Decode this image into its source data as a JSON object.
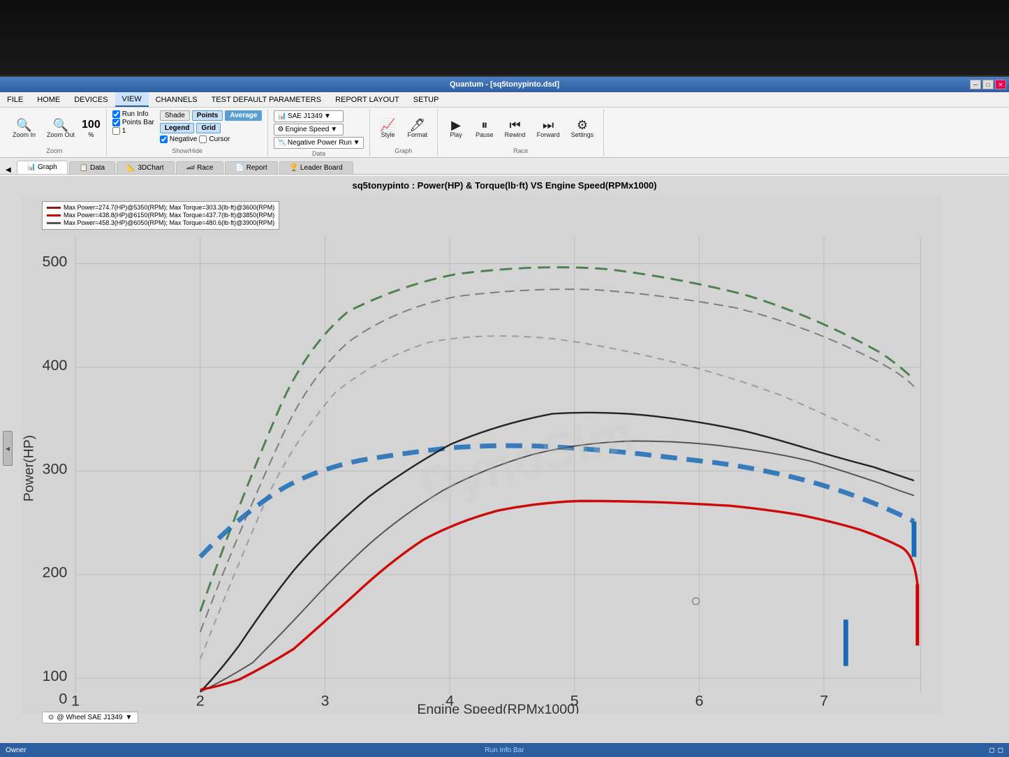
{
  "window": {
    "title": "Quantum - [sq5tonypinto.dsd]",
    "title_bar_color": "#3a6cb5"
  },
  "menu": {
    "items": [
      "FILE",
      "HOME",
      "DEVICES",
      "VIEW",
      "CHANNELS",
      "TEST DEFAULT PARAMETERS",
      "REPORT LAYOUT",
      "SETUP"
    ],
    "active": "VIEW"
  },
  "ribbon": {
    "zoom_group": {
      "label": "Zoom",
      "zoom_in": "Zoom In",
      "zoom_out": "Zoom Out",
      "percent": "100",
      "pct_label": "%"
    },
    "showhide_group": {
      "label": "Show/Hide",
      "run_info": "Run Info",
      "points_bar": "Points Bar",
      "item1": "1",
      "shade": "Shade",
      "points": "Points",
      "average": "Average",
      "legend": "Legend",
      "grid": "Grid",
      "negative": "Negative",
      "cursor": "Cursor"
    },
    "data_group": {
      "label": "Data",
      "sae": "SAE J1349",
      "engine_speed": "Engine Speed",
      "neg_power_run": "Negative Power Run"
    },
    "graph_group": {
      "label": "Graph",
      "style": "Style",
      "format": "Format"
    },
    "race_group": {
      "label": "Race",
      "play": "Play",
      "pause": "Pause",
      "rewind": "Rewind",
      "forward": "Forward",
      "settings": "Settings"
    }
  },
  "tabs": {
    "items": [
      "Graph",
      "Data",
      "3DChart",
      "Race",
      "Report",
      "Leader Board"
    ],
    "active": "Graph"
  },
  "chart": {
    "title": "sq5tonypinto : Power(HP) & Torque(lb·ft) VS Engine Speed(RPMx1000)",
    "legend": [
      {
        "color": "#8b0000",
        "text": "Max Power=274.7(HP)@5350(RPM); Max Torque=303.3(lb·ft)@3600(RPM)"
      },
      {
        "color": "#cc0000",
        "text": "Max Power=438.8(HP)@6150(RPM); Max Torque=437.7(lb·ft)@3850(RPM)"
      },
      {
        "color": "#555555",
        "text": "Max Power=458.3(HP)@6050(RPM); Max Torque=480.6(lb·ft)@3900(RPM)"
      }
    ],
    "x_axis_label": "Engine Speed(RPMx1000)",
    "y_axis_label": "Power(HP)",
    "x_ticks": [
      "1",
      "2",
      "3",
      "4",
      "5",
      "6",
      "7"
    ],
    "y_ticks": [
      "0",
      "100",
      "200",
      "300",
      "400",
      "500"
    ],
    "wheel_label": "@ Wheel SAE J1349"
  },
  "status_bar": {
    "owner": "Owner",
    "run_info": "Run Info Bar"
  }
}
